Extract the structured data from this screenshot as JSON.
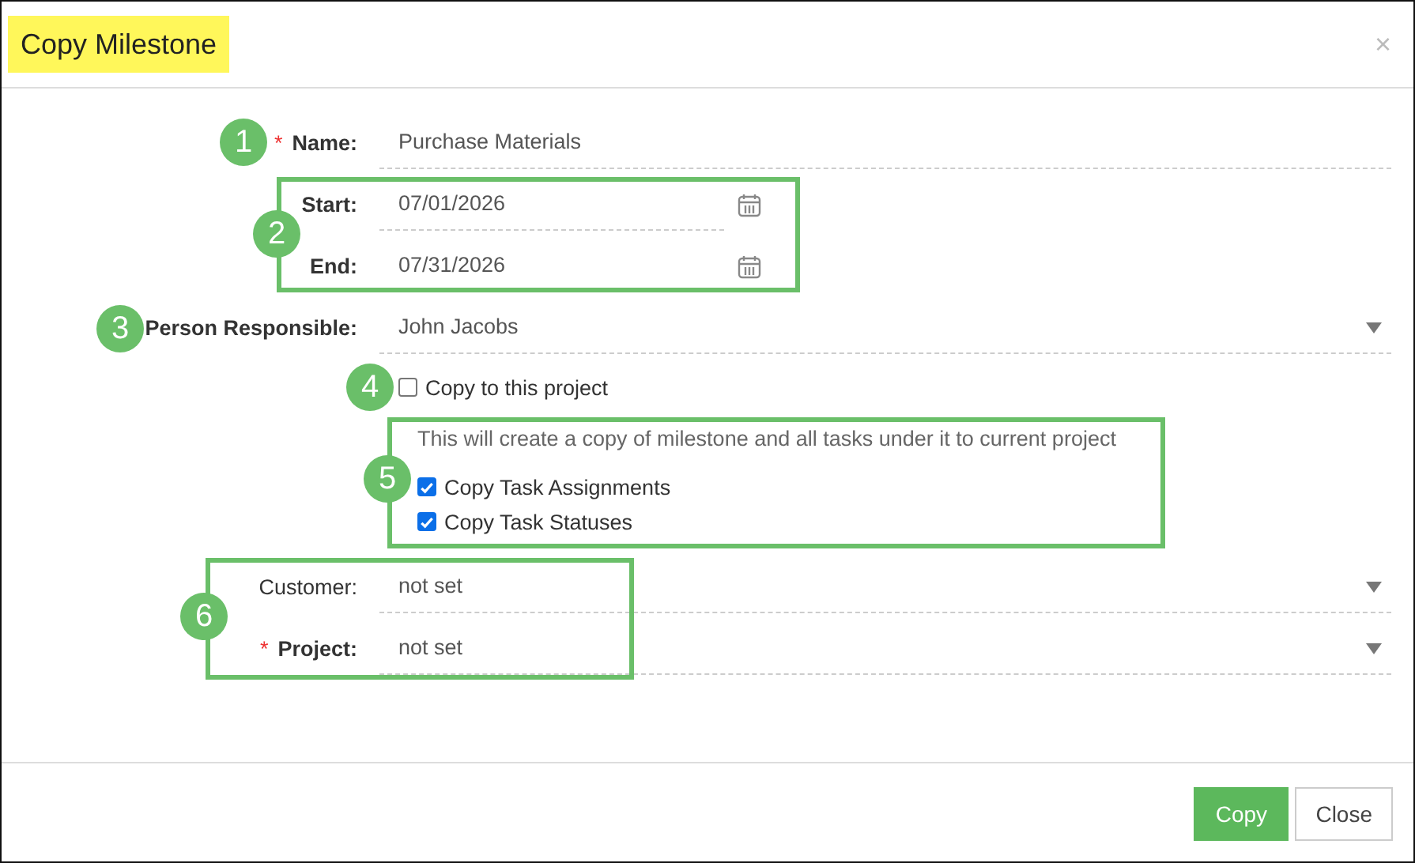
{
  "dialog": {
    "title": "Copy Milestone",
    "title_highlighted": true,
    "close": "×"
  },
  "fields": [
    {
      "kind": "text",
      "label": "Name:",
      "required_mark": "*",
      "bold": true,
      "value": "Purchase Materials"
    },
    {
      "kind": "date",
      "label": "Start:",
      "bold": true,
      "value": "07/01/2026"
    },
    {
      "kind": "date",
      "label": "End:",
      "bold": true,
      "value": "07/31/2026"
    },
    {
      "kind": "select",
      "label": "Person Responsible:",
      "bold": true,
      "value": "John Jacobs"
    }
  ],
  "copy_to_project": {
    "label": "Copy to this project",
    "checked": false
  },
  "note": "This will create a copy of milestone and all tasks under it to current project",
  "options": [
    {
      "label": "Copy Task Assignments",
      "checked": true
    },
    {
      "label": "Copy Task Statuses",
      "checked": true
    }
  ],
  "target_fields": [
    {
      "kind": "select",
      "label": "Customer:",
      "bold": false,
      "value": "not set"
    },
    {
      "kind": "select",
      "label": "Project:",
      "required_mark": "*",
      "bold": true,
      "value": "not set"
    }
  ],
  "buttons": [
    {
      "label": "Copy",
      "kind": "primary"
    },
    {
      "label": "Close",
      "kind": "default"
    }
  ],
  "callouts": [
    {
      "number": "1"
    },
    {
      "number": "2"
    },
    {
      "number": "3"
    },
    {
      "number": "4"
    },
    {
      "number": "5"
    },
    {
      "number": "6"
    }
  ]
}
